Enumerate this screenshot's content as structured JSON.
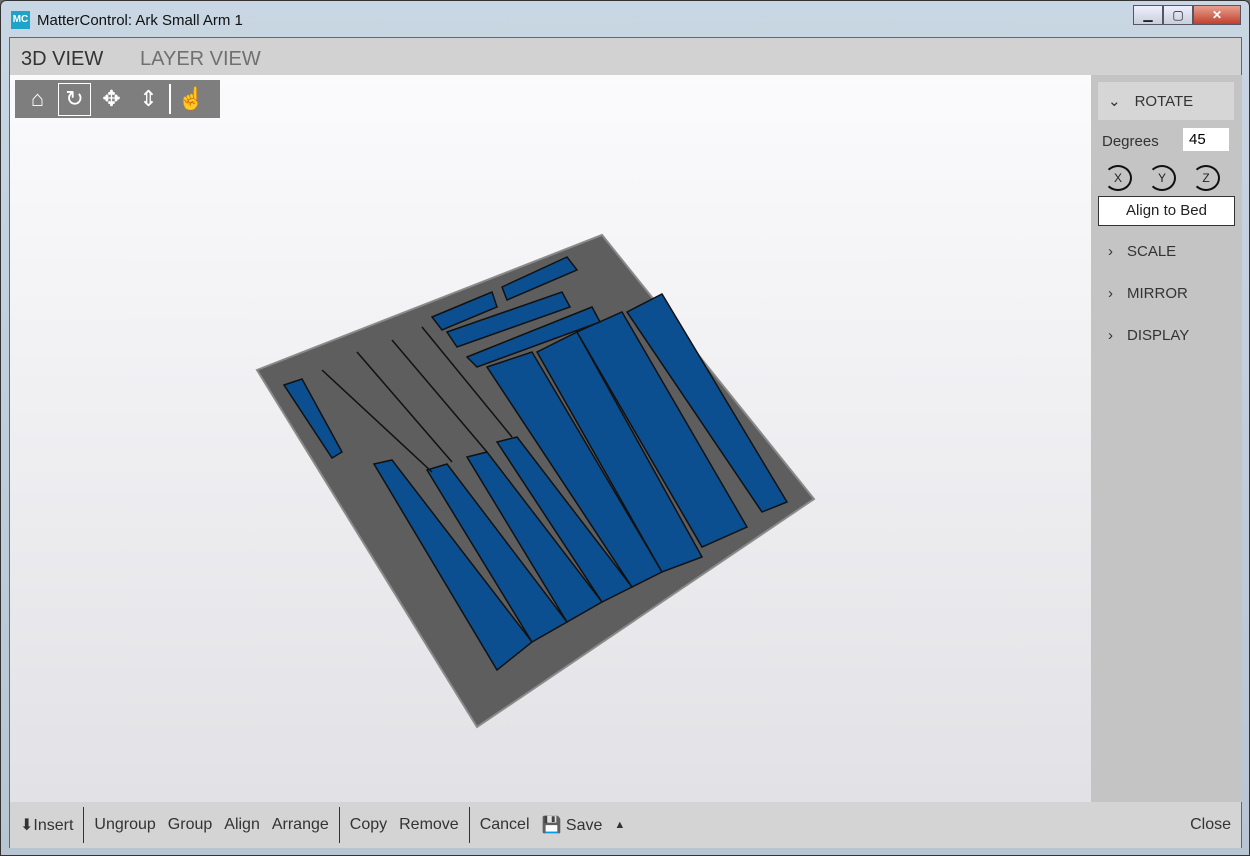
{
  "window": {
    "title": "MatterControl: Ark Small Arm 1",
    "logo": "MC"
  },
  "tabs": [
    {
      "label": "3D VIEW",
      "active": true
    },
    {
      "label": "LAYER VIEW",
      "active": false
    }
  ],
  "view_toolbar": [
    "home-icon",
    "rotate-icon",
    "move-icon",
    "zoom-icon",
    "select-hand-icon"
  ],
  "panel": {
    "rotate": {
      "label": "ROTATE",
      "degrees_label": "Degrees",
      "degrees_value": "45",
      "axes": [
        "X",
        "Y",
        "Z"
      ],
      "align_label": "Align to Bed"
    },
    "sections": [
      "SCALE",
      "MIRROR",
      "DISPLAY"
    ]
  },
  "bottom": {
    "insert": "Insert",
    "ungroup": "Ungroup",
    "group": "Group",
    "align": "Align",
    "arrange": "Arrange",
    "copy": "Copy",
    "remove": "Remove",
    "cancel": "Cancel",
    "save": "Save",
    "close": "Close"
  },
  "colors": {
    "part": "#0b4f91",
    "bed": "#5c5c5c",
    "accent": "#1fa3c9"
  }
}
